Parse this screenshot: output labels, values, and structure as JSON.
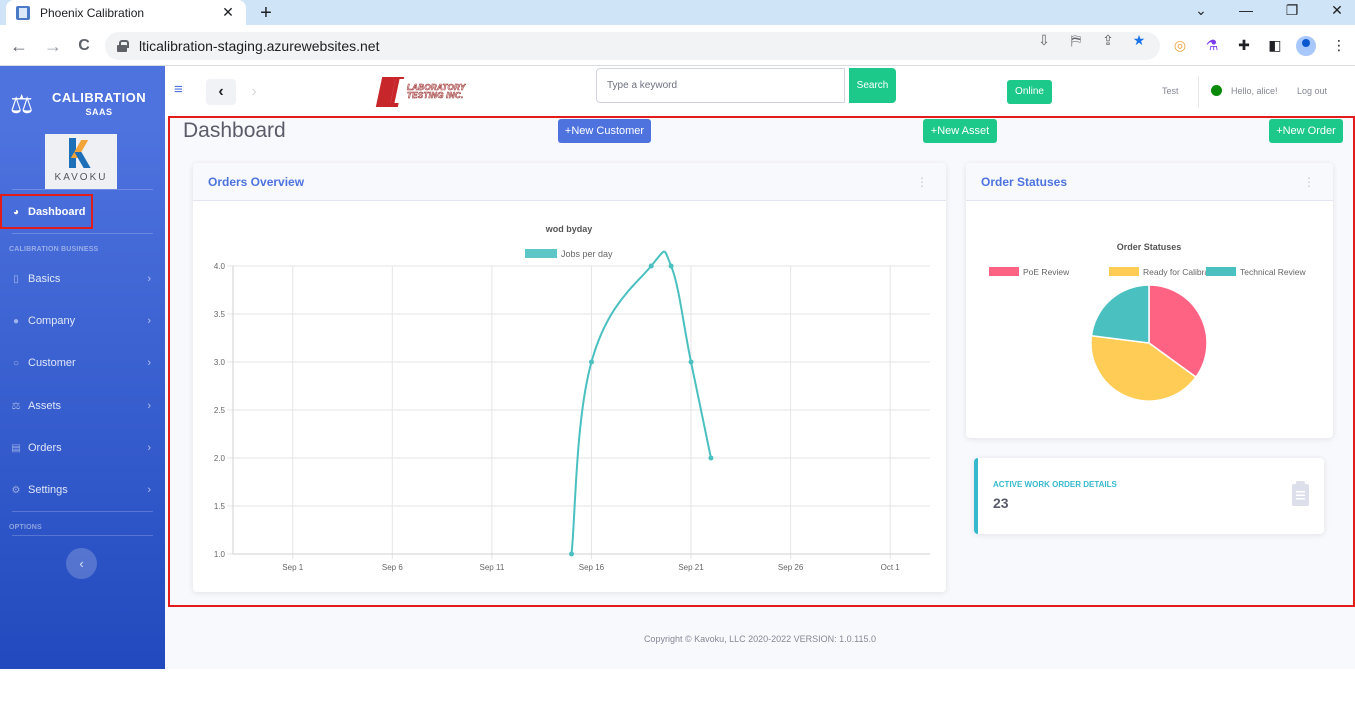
{
  "browser": {
    "tab_title": "Phoenix Calibration",
    "tab_close": "✕",
    "new_tab": "+",
    "url": "lticalibration-staging.azurewebsites.net",
    "back": "←",
    "forward": "→",
    "reload": "C",
    "menu": "⋮",
    "window_controls": {
      "dropdown": "⌄",
      "minimize": "—",
      "restore": "❐",
      "close": "✕"
    }
  },
  "sidebar": {
    "brand_title": "CALIBRATION",
    "brand_sub": "SAAS",
    "logo_word": "KAVOKU",
    "active_item": {
      "label": "Dashboard",
      "icon": "tachometer-icon"
    },
    "section_business": "CALIBRATION BUSINESS",
    "items": [
      {
        "label": "Basics",
        "icon": "mobile-icon"
      },
      {
        "label": "Company",
        "icon": "user-icon"
      },
      {
        "label": "Customer",
        "icon": "user-outline-icon"
      },
      {
        "label": "Assets",
        "icon": "balance-icon"
      },
      {
        "label": "Orders",
        "icon": "file-icon"
      },
      {
        "label": "Settings",
        "icon": "gear-icon"
      }
    ],
    "section_options": "OPTIONS",
    "collapse": "‹"
  },
  "topbar": {
    "menu_icon": "≡",
    "back": "‹",
    "forward": "›",
    "company_logo_text": "LABORATORY TESTING INC.",
    "search_placeholder": "Type a keyword",
    "search_label": "Search",
    "online_label": "Online",
    "user_name": "Test",
    "greeting": "Hello, alice!",
    "logout": "Log out",
    "status_color": "#0a8a0a"
  },
  "page": {
    "title": "Dashboard",
    "new_customer": "+New Customer",
    "new_asset": "+New Asset",
    "new_order": "+New Order"
  },
  "orders_card": {
    "title": "Orders Overview",
    "menu": "⋮"
  },
  "status_card": {
    "title": "Order Statuses",
    "menu": "⋮"
  },
  "work_orders": {
    "label": "ACTIVE WORK ORDER DETAILS",
    "value": "23",
    "icon": "clipboard-icon"
  },
  "footer": "Copyright © Kavoku, LLC 2020-2022 VERSION: 1.0.115.0",
  "chart_data": [
    {
      "type": "line",
      "title": "wod byday",
      "series": [
        {
          "name": "Jobs per day",
          "color": "#4bc0c0",
          "points": [
            {
              "x": "2022-09-15",
              "y": 1
            },
            {
              "x": "2022-09-16",
              "y": 3
            },
            {
              "x": "2022-09-19",
              "y": 4
            },
            {
              "x": "2022-09-20",
              "y": 4
            },
            {
              "x": "2022-09-21",
              "y": 3
            },
            {
              "x": "2022-09-22",
              "y": 2
            }
          ]
        }
      ],
      "x_ticks": [
        "Sep 1",
        "Sep 6",
        "Sep 11",
        "Sep 16",
        "Sep 21",
        "Sep 26",
        "Oct 1"
      ],
      "x_range": [
        "2022-08-29",
        "2022-10-03"
      ],
      "y_ticks": [
        1.0,
        1.5,
        2.0,
        2.5,
        3.0,
        3.5,
        4.0
      ],
      "ylim": [
        1.0,
        4.0
      ],
      "grid": true,
      "legend": "top"
    },
    {
      "type": "pie",
      "title": "Order Statuses",
      "slices": [
        {
          "label": "PoE Review",
          "value": 35,
          "color": "#ff6384"
        },
        {
          "label": "Ready for Calibration",
          "value": 42,
          "color": "#ffcd56"
        },
        {
          "label": "Technical Review",
          "value": 23,
          "color": "#4bc0c0"
        }
      ],
      "legend": "top"
    }
  ]
}
